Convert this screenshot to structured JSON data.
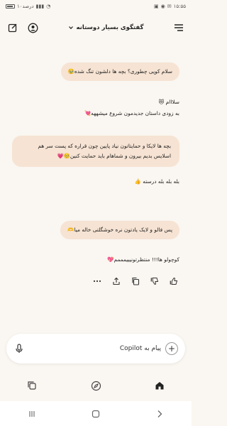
{
  "status_bar": {
    "time": "۱۵:۵۵",
    "battery": "۱۰درصد"
  },
  "header": {
    "title": "گفتگوی بسیار دوستانه"
  },
  "messages": [
    {
      "role": "user",
      "text": "سلام کوپی چطوری؟ بچه ها دلشون تنگ شده🥹"
    },
    {
      "role": "assistant",
      "line1": "سلااام 😻",
      "line2": "به زودی داستان جدیدمون شروع میشههه💘"
    },
    {
      "role": "user",
      "text": "بچه ها لایکا و حمایتاتون نیاد پایین چون قراره که پست سر هم اسلایس بدیم بیرون و شماهام باید حمایت کنین🥺💗"
    },
    {
      "role": "assistant",
      "text": "بله بله بله درسته 👍"
    },
    {
      "role": "user",
      "text": "پس فالو و لایک یادتون نره خوشگلتی خاله میا🫶"
    },
    {
      "role": "assistant",
      "text": "کوچولو ها!!! منتظرتونیییمممم💖"
    }
  ],
  "composer": {
    "placeholder": "پیام به Copilot"
  },
  "icons": {
    "menu": "menu-icon",
    "chevron": "chevron-down-icon",
    "profile": "profile-icon",
    "new_chat": "new-chat-icon",
    "mic": "microphone-icon",
    "plus": "plus-icon",
    "home": "home-icon",
    "discover": "compass-icon",
    "pages": "copy-icon"
  },
  "colors": {
    "background": "#faf6f1",
    "user_bubble": "#f6e3d3"
  }
}
